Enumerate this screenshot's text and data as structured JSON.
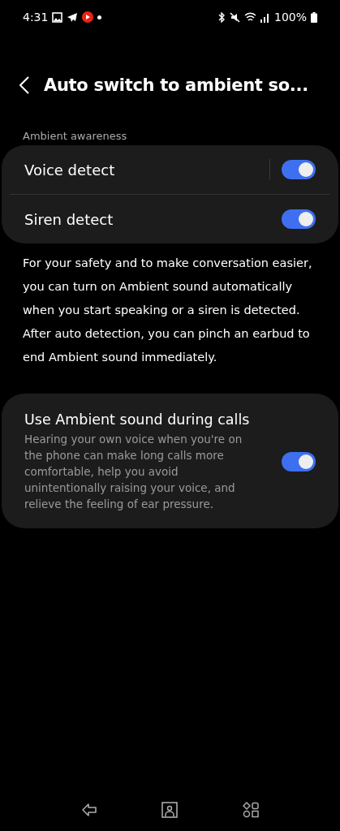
{
  "status_bar": {
    "time": "4:31",
    "battery": "100%"
  },
  "header": {
    "title": "Auto switch to ambient so..."
  },
  "section_label": "Ambient awareness",
  "toggles": [
    {
      "label": "Voice detect",
      "on": true,
      "divider": true
    },
    {
      "label": "Siren detect",
      "on": true,
      "divider": false
    }
  ],
  "description": "For your safety and to make conversation easier, you can turn on Ambient sound automatically when you start speaking or a siren is detected. After auto detection, you can pinch an earbud to end Ambient sound immediately.",
  "calls_setting": {
    "title": "Use Ambient sound during calls",
    "summary": "Hearing your own voice when you're on the phone can make long calls more comfortable, help you avoid unintentionally raising your voice, and relieve the feeling of ear pressure.",
    "on": true
  }
}
